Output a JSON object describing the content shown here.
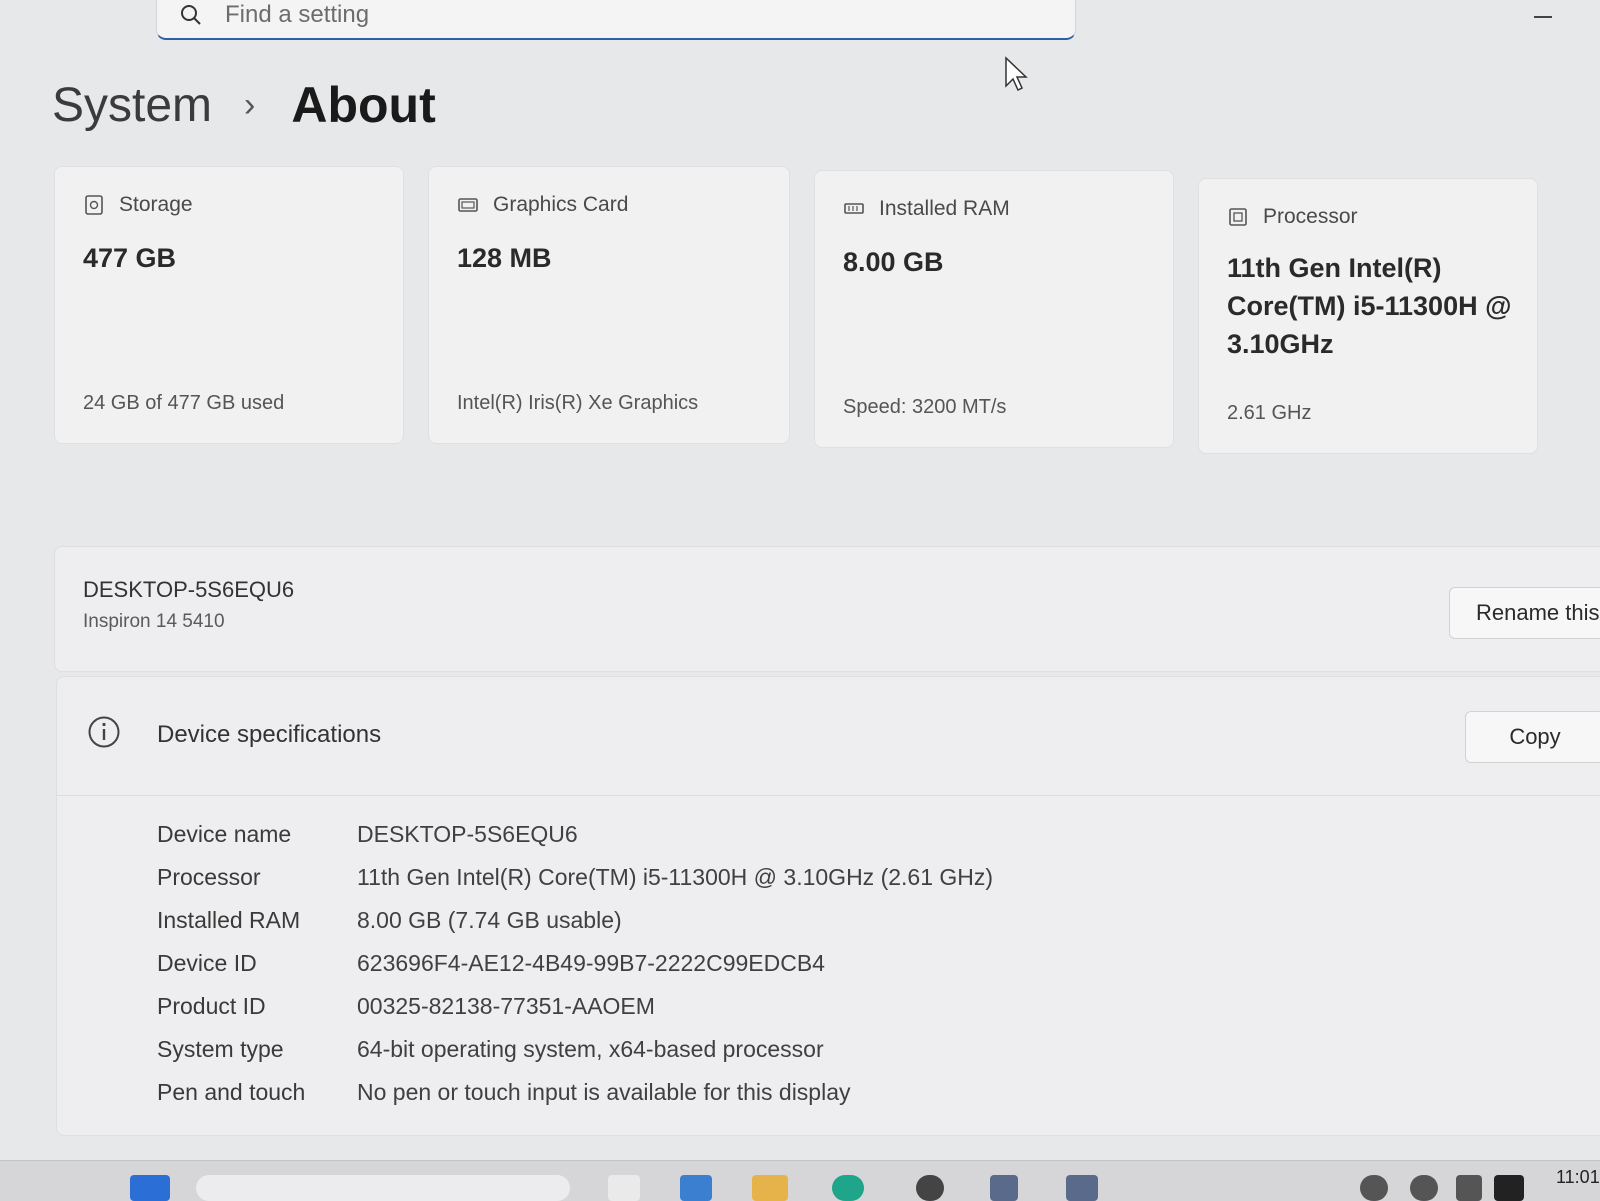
{
  "search": {
    "placeholder": "Find a setting"
  },
  "breadcrumb": {
    "parent": "System",
    "separator": "›",
    "current": "About"
  },
  "cards": [
    {
      "icon": "storage-icon",
      "label": "Storage",
      "value": "477 GB",
      "sub": "24 GB of 477 GB used"
    },
    {
      "icon": "graphics-card-icon",
      "label": "Graphics Card",
      "value": "128 MB",
      "sub": "Intel(R) Iris(R) Xe Graphics"
    },
    {
      "icon": "ram-icon",
      "label": "Installed RAM",
      "value": "8.00 GB",
      "sub": "Speed: 3200 MT/s"
    },
    {
      "icon": "processor-icon",
      "label": "Processor",
      "value_lines": [
        "11th Gen Intel(R)",
        "Core(TM) i5-11300H @",
        "3.10GHz"
      ],
      "sub": "2.61 GHz"
    }
  ],
  "device": {
    "name": "DESKTOP-5S6EQU6",
    "model": "Inspiron 14 5410",
    "rename_label": "Rename this"
  },
  "specs": {
    "title": "Device specifications",
    "copy_label": "Copy",
    "rows": [
      {
        "key": "Device name",
        "value": "DESKTOP-5S6EQU6"
      },
      {
        "key": "Processor",
        "value": "11th Gen Intel(R) Core(TM) i5-11300H @ 3.10GHz (2.61 GHz)"
      },
      {
        "key": "Installed RAM",
        "value": "8.00 GB (7.74 GB usable)"
      },
      {
        "key": "Device ID",
        "value": "623696F4-AE12-4B49-99B7-2222C99EDCB4"
      },
      {
        "key": "Product ID",
        "value": "00325-82138-77351-AAOEM"
      },
      {
        "key": "System type",
        "value": "64-bit operating system, x64-based processor"
      },
      {
        "key": "Pen and touch",
        "value": "No pen or touch input is available for this display"
      }
    ]
  },
  "taskbar": {
    "clock": "11:01"
  }
}
